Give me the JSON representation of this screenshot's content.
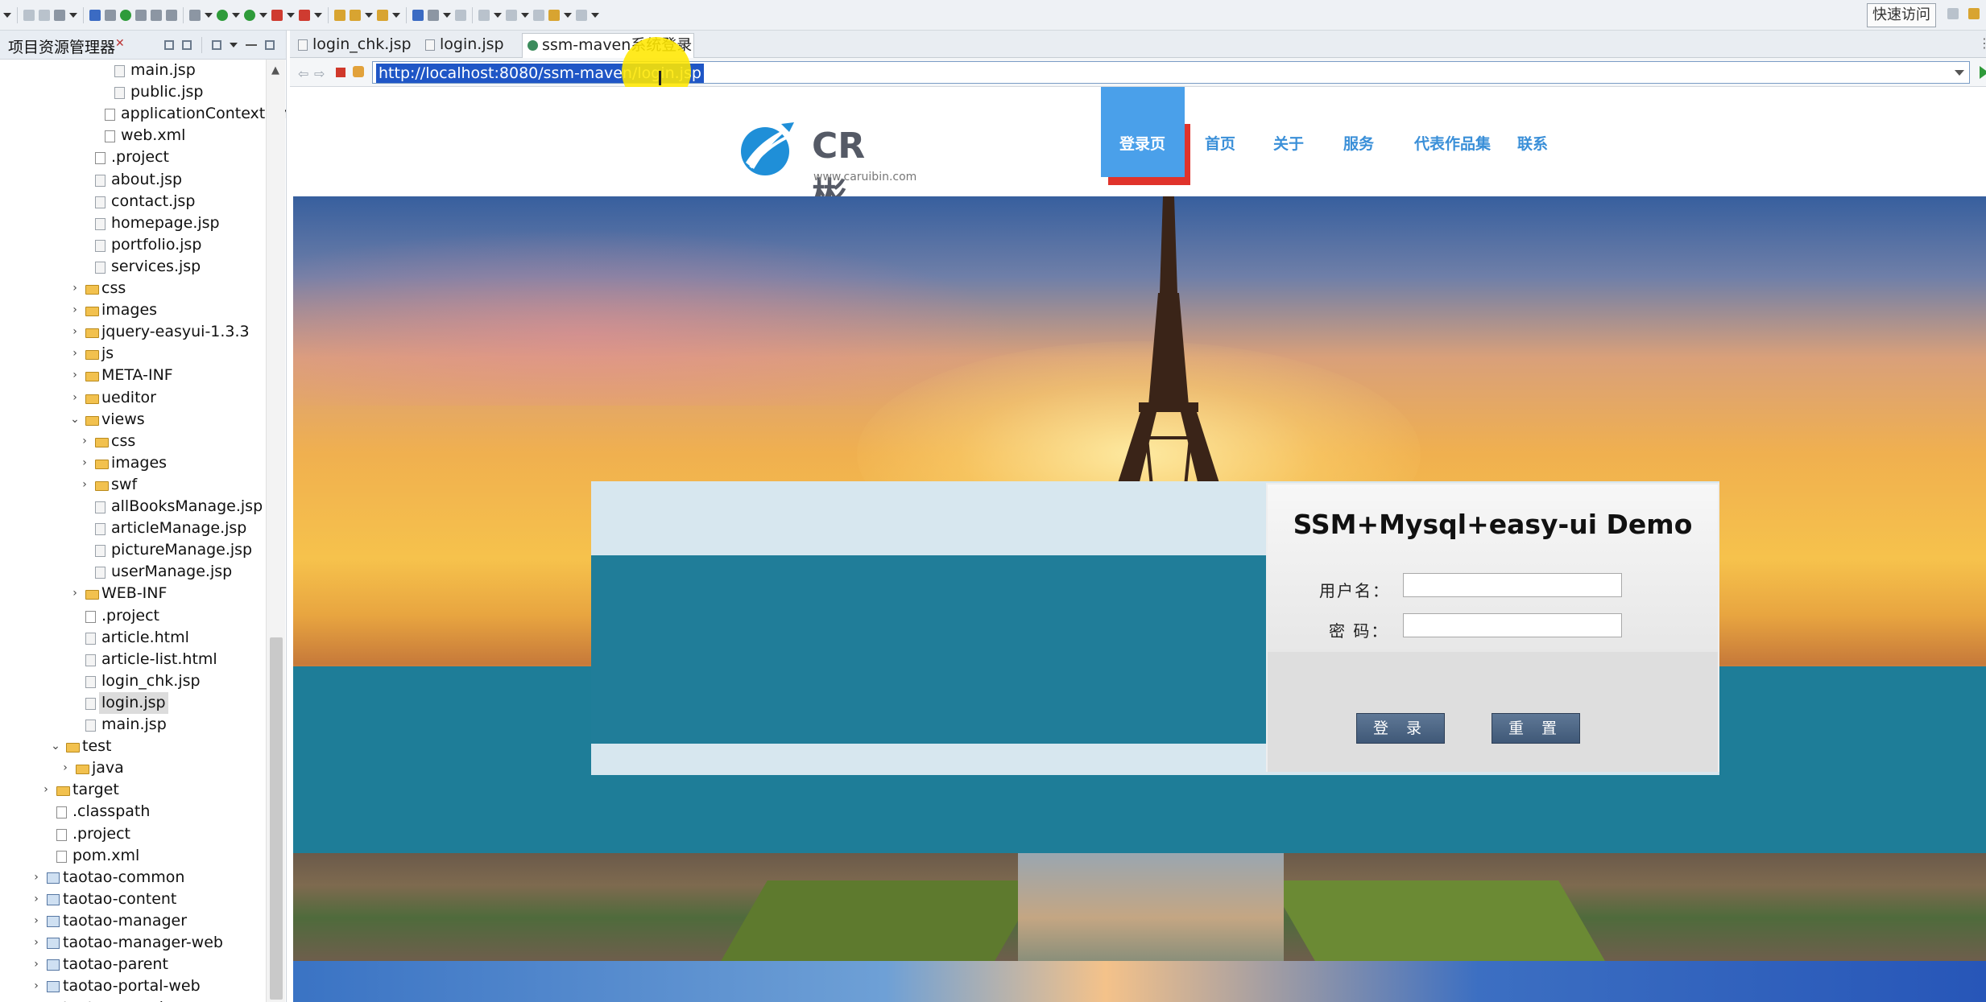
{
  "ide": {
    "quick_access": "快速访问"
  },
  "explorer": {
    "title": "项目资源管理器",
    "items": [
      {
        "label": "main.jsp",
        "icon": "jsp-file-icon",
        "indent": 7
      },
      {
        "label": "public.jsp",
        "icon": "jsp-file-icon",
        "indent": 7
      },
      {
        "label": "applicationContext.xml",
        "icon": "xml-file-icon",
        "indent": 6
      },
      {
        "label": "web.xml",
        "icon": "xml-file-icon",
        "indent": 6
      },
      {
        "label": ".project",
        "icon": "xml-file-icon",
        "indent": 5
      },
      {
        "label": "about.jsp",
        "icon": "jsp-file-icon",
        "indent": 5
      },
      {
        "label": "contact.jsp",
        "icon": "jsp-file-icon",
        "indent": 5
      },
      {
        "label": "homepage.jsp",
        "icon": "jsp-file-icon",
        "indent": 5
      },
      {
        "label": "portfolio.jsp",
        "icon": "jsp-file-icon",
        "indent": 5
      },
      {
        "label": "services.jsp",
        "icon": "jsp-file-icon",
        "indent": 5
      },
      {
        "label": "css",
        "icon": "folder-icon",
        "indent": 4,
        "toggle": "›"
      },
      {
        "label": "images",
        "icon": "folder-icon",
        "indent": 4,
        "toggle": "›"
      },
      {
        "label": "jquery-easyui-1.3.3",
        "icon": "folder-icon",
        "indent": 4,
        "toggle": "›"
      },
      {
        "label": "js",
        "icon": "folder-icon",
        "indent": 4,
        "toggle": "›"
      },
      {
        "label": "META-INF",
        "icon": "folder-icon",
        "indent": 4,
        "toggle": "›"
      },
      {
        "label": "ueditor",
        "icon": "folder-icon",
        "indent": 4,
        "toggle": "›"
      },
      {
        "label": "views",
        "icon": "folder-icon",
        "indent": 4,
        "toggle": "⌄"
      },
      {
        "label": "css",
        "icon": "folder-icon",
        "indent": 5,
        "toggle": "›"
      },
      {
        "label": "images",
        "icon": "folder-icon",
        "indent": 5,
        "toggle": "›"
      },
      {
        "label": "swf",
        "icon": "folder-icon",
        "indent": 5,
        "toggle": "›"
      },
      {
        "label": "allBooksManage.jsp",
        "icon": "jsp-file-icon",
        "indent": 5
      },
      {
        "label": "articleManage.jsp",
        "icon": "jsp-file-icon",
        "indent": 5
      },
      {
        "label": "pictureManage.jsp",
        "icon": "jsp-file-icon",
        "indent": 5
      },
      {
        "label": "userManage.jsp",
        "icon": "jsp-file-icon",
        "indent": 5
      },
      {
        "label": "WEB-INF",
        "icon": "folder-icon",
        "indent": 4,
        "toggle": "›"
      },
      {
        "label": ".project",
        "icon": "xml-file-icon",
        "indent": 4
      },
      {
        "label": "article.html",
        "icon": "html-file-icon",
        "indent": 4
      },
      {
        "label": "article-list.html",
        "icon": "html-file-icon",
        "indent": 4
      },
      {
        "label": "login_chk.jsp",
        "icon": "jsp-file-icon",
        "indent": 4
      },
      {
        "label": "login.jsp",
        "icon": "jsp-file-icon",
        "indent": 4,
        "selected": true
      },
      {
        "label": "main.jsp",
        "icon": "jsp-file-icon",
        "indent": 4
      },
      {
        "label": "test",
        "icon": "folder-icon",
        "indent": 2,
        "toggle": "⌄"
      },
      {
        "label": "java",
        "icon": "folder-icon",
        "indent": 3,
        "toggle": "›"
      },
      {
        "label": "target",
        "icon": "folder-icon",
        "indent": 1,
        "toggle": "›"
      },
      {
        "label": ".classpath",
        "icon": "xml-file-icon",
        "indent": 1
      },
      {
        "label": ".project",
        "icon": "xml-file-icon",
        "indent": 1
      },
      {
        "label": "pom.xml",
        "icon": "xml-file-icon",
        "indent": 1
      },
      {
        "label": "taotao-common",
        "icon": "project-icon",
        "indent": 0,
        "toggle": "›"
      },
      {
        "label": "taotao-content",
        "icon": "project-icon",
        "indent": 0,
        "toggle": "›"
      },
      {
        "label": "taotao-manager",
        "icon": "project-icon",
        "indent": 0,
        "toggle": "›"
      },
      {
        "label": "taotao-manager-web",
        "icon": "project-icon",
        "indent": 0,
        "toggle": "›"
      },
      {
        "label": "taotao-parent",
        "icon": "project-icon",
        "indent": 0,
        "toggle": "›"
      },
      {
        "label": "taotao-portal-web",
        "icon": "project-icon",
        "indent": 0,
        "toggle": "›"
      },
      {
        "label": "taotao-search",
        "icon": "project-icon",
        "indent": 0,
        "toggle": "›"
      }
    ]
  },
  "editor_tabs": [
    {
      "label": "login_chk.jsp",
      "active": false
    },
    {
      "label": "login.jsp",
      "active": false
    },
    {
      "label": "ssm-maven系统登录",
      "active": true
    }
  ],
  "browser": {
    "url": "http://localhost:8080/ssm-maven/login.jsp"
  },
  "site": {
    "logo_name": "CR彬",
    "logo_sub": "www.caruibin.com",
    "menu": [
      "登录页",
      "首页",
      "关于",
      "服务",
      "代表作品集",
      "联系"
    ],
    "active_menu_index": 0
  },
  "login": {
    "title": "SSM+Mysql+easy-ui Demo",
    "username_label": "用户名：",
    "password_label": "密 码：",
    "username_value": "",
    "password_value": "",
    "login_button": "登 录",
    "reset_button": "重 置"
  },
  "colors": {
    "menu_active_bg": "#4aa0ea",
    "menu_active_accent": "#e0332b",
    "menu_text": "#3a8fd8",
    "band": "#1e7d98",
    "button": "#4f6886"
  }
}
